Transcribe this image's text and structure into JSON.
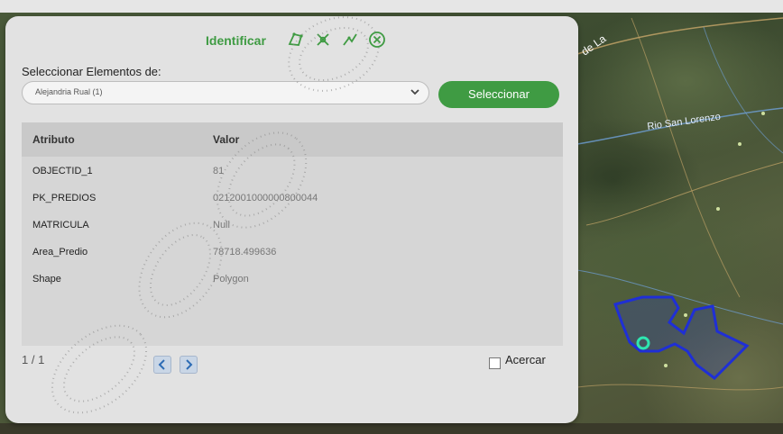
{
  "map": {
    "place_labels": [
      "de La",
      "Rio San Lorenzo"
    ],
    "parcel_color": "#1f2fd6",
    "marker_color": "#2ee6b0"
  },
  "dialog": {
    "title": "Identificar",
    "tool_icons": [
      "select-polygon-icon",
      "select-point-icon",
      "select-line-icon",
      "clear-selection-icon"
    ],
    "select_label": "Seleccionar Elementos de:",
    "layer_select": {
      "value": "Alejandria Rual (1)"
    },
    "select_button": "Seleccionar",
    "table": {
      "headers": [
        "Atributo",
        "Valor"
      ],
      "rows": [
        {
          "attr": "OBJECTID_1",
          "value": "81"
        },
        {
          "attr": "PK_PREDIOS",
          "value": "0212001000000800044"
        },
        {
          "attr": "MATRICULA",
          "value": "Null"
        },
        {
          "attr": "Area_Predio",
          "value": "78718.499636"
        },
        {
          "attr": "Shape",
          "value": "Polygon"
        }
      ]
    },
    "pager": "1 / 1",
    "zoom_label": "Acercar",
    "zoom_checked": false
  },
  "colors": {
    "accent": "#3f9b43",
    "dialog_bg": "#e2e2e2",
    "table_header_bg": "#c9c9c9"
  }
}
